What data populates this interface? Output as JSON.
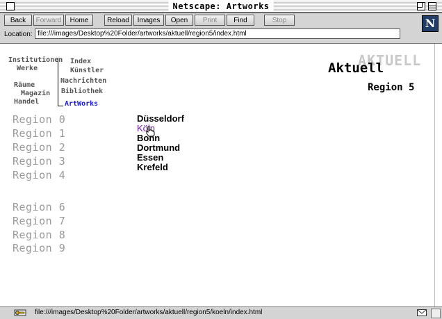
{
  "window": {
    "title": "Netscape: Artworks"
  },
  "toolbar": {
    "buttons": [
      {
        "label": "Back",
        "enabled": true
      },
      {
        "label": "Forward",
        "enabled": false
      },
      {
        "label": "Home",
        "enabled": true
      },
      {
        "label": "Reload",
        "enabled": true
      },
      {
        "label": "Images",
        "enabled": true
      },
      {
        "label": "Open",
        "enabled": true
      },
      {
        "label": "Print",
        "enabled": false
      },
      {
        "label": "Find",
        "enabled": true
      },
      {
        "label": "Stop",
        "enabled": false
      }
    ],
    "location_label": "Location:",
    "location_value": "file:///images/Desktop%20Folder/artworks/aktuell/region5/index.html",
    "logo_letter": "N"
  },
  "page": {
    "nav": {
      "left": [
        "Institutionen",
        "Werke",
        "Räume",
        "Magazin",
        "Handel"
      ],
      "right": [
        "Index",
        "Künstler",
        "Nachrichten",
        "Bibliothek"
      ],
      "active": "ArtWorks"
    },
    "heading_bg": "AKTUELL",
    "heading": "Aktuell",
    "subheading": "Region 5",
    "regions": [
      "Region 0",
      "Region 1",
      "Region 2",
      "Region 3",
      "Region 4",
      "Region 6",
      "Region 7",
      "Region 8",
      "Region 9"
    ],
    "cities": [
      "Düsseldorf",
      "Köln",
      "Bonn",
      "Dortmund",
      "Essen",
      "Krefeld"
    ],
    "visited_city_index": 1
  },
  "status": {
    "text": "file:///images/Desktop%20Folder/artworks/aktuell/region5/koeln/index.html"
  },
  "icons": {
    "close": "close-box-icon",
    "zoom": "zoom-box-icon",
    "collapse": "collapse-box-icon",
    "security": "security-key-icon",
    "mail": "mail-icon",
    "cursor": "hand-pointer-icon"
  },
  "colors": {
    "visited_link": "#6a1a9a",
    "active_nav": "#1a1acc",
    "region_gray": "#9a9a9a"
  }
}
